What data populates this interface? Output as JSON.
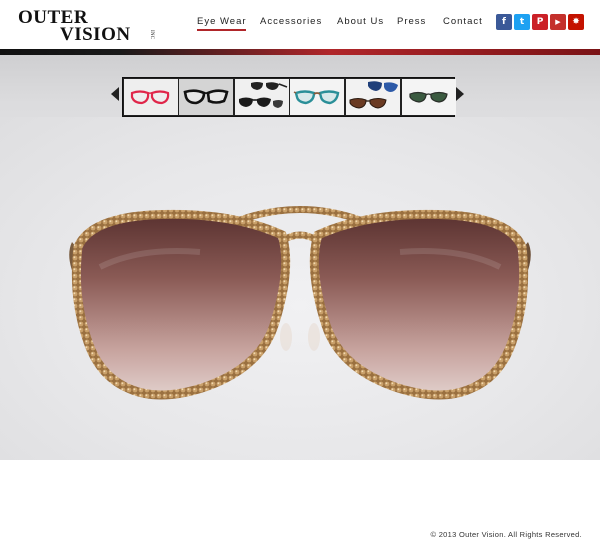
{
  "brand": {
    "line1": "OUTER",
    "line2": "VISION",
    "suffix": "INC"
  },
  "nav": {
    "items": [
      {
        "label": "Eye Wear",
        "active": true
      },
      {
        "label": "Accessories",
        "active": false
      },
      {
        "label": "About Us",
        "active": false
      },
      {
        "label": "Press",
        "active": false
      },
      {
        "label": "Contact",
        "active": false
      }
    ]
  },
  "social": {
    "items": [
      {
        "name": "facebook-icon",
        "glyph": "f",
        "color": "#3b5998"
      },
      {
        "name": "twitter-icon",
        "glyph": "t",
        "color": "#1da1f2"
      },
      {
        "name": "pinterest-icon",
        "glyph": "P",
        "color": "#cb2027"
      },
      {
        "name": "youtube-icon",
        "glyph": "▶",
        "color": "#c4302b"
      },
      {
        "name": "yelp-icon",
        "glyph": "✸",
        "color": "#c41200"
      }
    ]
  },
  "gallery": {
    "thumbnails": [
      {
        "name": "thumb-red-frames",
        "selected": false
      },
      {
        "name": "thumb-black-cateye",
        "selected": true
      },
      {
        "name": "thumb-black-sunglasses-pair",
        "selected": false
      },
      {
        "name": "thumb-teal-frames",
        "selected": false
      },
      {
        "name": "thumb-blue-brown-sunglasses",
        "selected": false
      },
      {
        "name": "thumb-green-sunglasses",
        "selected": false
      }
    ]
  },
  "colors": {
    "accent": "#b0262a",
    "text": "#222222"
  },
  "footer": {
    "copyright": "© 2013 Outer Vision. All Rights Reserved."
  }
}
